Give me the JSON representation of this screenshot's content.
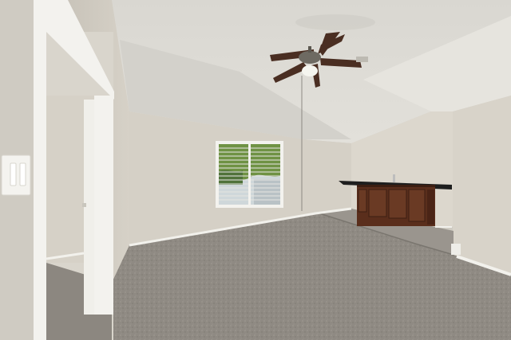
{
  "scene": {
    "kind": "photo",
    "subject": "empty-room-interior",
    "elements": [
      "vaulted-ceiling",
      "ceiling-fan",
      "window-with-blinds",
      "carpet-floor",
      "raised-carpet-platform",
      "wet-bar-cabinets",
      "open-doorway",
      "light-switch-plate",
      "baseboards",
      "air-vent"
    ],
    "colors": {
      "ceiling": "#dcdad3",
      "wall": "#d8d3c9",
      "carpet": "#8f8a83",
      "cabinet_wood": "#5a2e1c",
      "countertop": "#1e1e1e",
      "fan_blade": "#4a2e22",
      "trim": "#f2f1ec",
      "window_foliage": "#5f8a3e"
    }
  }
}
